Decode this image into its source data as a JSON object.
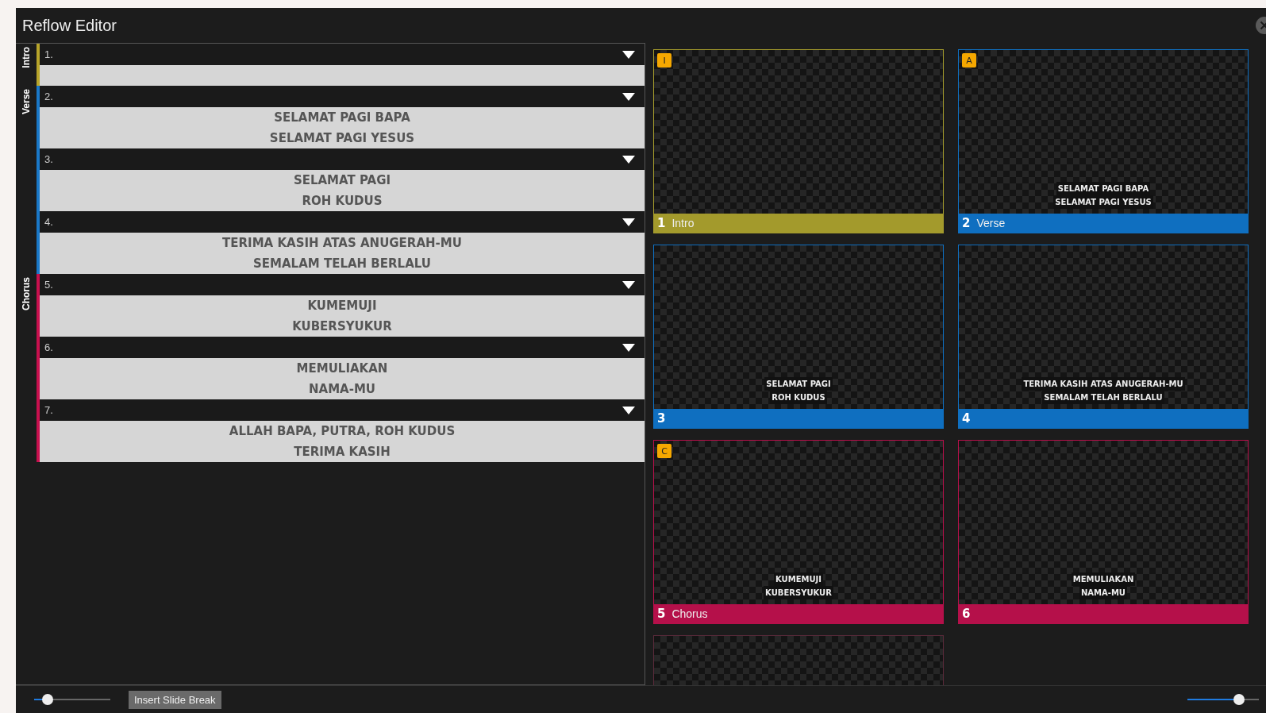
{
  "window": {
    "title": "Reflow Editor"
  },
  "groups": [
    {
      "label": "Intro",
      "color": "#b8a52a",
      "slides": [
        {
          "number": "1."
        }
      ]
    },
    {
      "label": "Verse",
      "color": "#1a78c8",
      "slides": [
        {
          "number": "2.",
          "lines": [
            "SELAMAT PAGI BAPA",
            "SELAMAT PAGI YESUS"
          ]
        },
        {
          "number": "3.",
          "lines": [
            "SELAMAT PAGI",
            "ROH KUDUS"
          ]
        },
        {
          "number": "4.",
          "lines": [
            "TERIMA KASIH ATAS ANUGERAH-MU",
            "SEMALAM TELAH BERLALU"
          ]
        }
      ]
    },
    {
      "label": "Chorus",
      "color": "#c8104e",
      "slides": [
        {
          "number": "5.",
          "lines": [
            "KUMEMUJI",
            "KUBERSYUKUR"
          ]
        },
        {
          "number": "6.",
          "lines": [
            "MEMULIAKAN",
            "NAMA-MU"
          ]
        },
        {
          "number": "7.",
          "lines": [
            "ALLAH BAPA, PUTRA, ROH KUDUS",
            "TERIMA KASIH"
          ]
        }
      ]
    }
  ],
  "thumbnails": [
    {
      "number": "1",
      "label": "Intro",
      "badge": "I",
      "color": "#a39a2c"
    },
    {
      "number": "2",
      "label": "Verse",
      "badge": "A",
      "color": "#0f6fc0",
      "lines": [
        "SELAMAT PAGI BAPA",
        "SELAMAT PAGI YESUS"
      ]
    },
    {
      "number": "3",
      "color": "#0f6fc0",
      "lines": [
        "SELAMAT PAGI",
        "ROH KUDUS"
      ]
    },
    {
      "number": "4",
      "color": "#0f6fc0",
      "lines": [
        "TERIMA KASIH ATAS ANUGERAH-MU",
        "SEMALAM TELAH BERLALU"
      ]
    },
    {
      "number": "5",
      "label": "Chorus",
      "badge": "C",
      "color": "#b5104a",
      "lines": [
        "KUMEMUJI",
        "KUBERSYUKUR"
      ]
    },
    {
      "number": "6",
      "color": "#b5104a",
      "lines": [
        "MEMULIAKAN",
        "NAMA-MU"
      ]
    },
    {
      "color": "#5a2a3a"
    }
  ],
  "bottom_bar": {
    "zoom_slider": {
      "level": 0.18
    },
    "insert_button": "Insert Slide Break",
    "size_slider": {
      "level": 0.72
    }
  }
}
